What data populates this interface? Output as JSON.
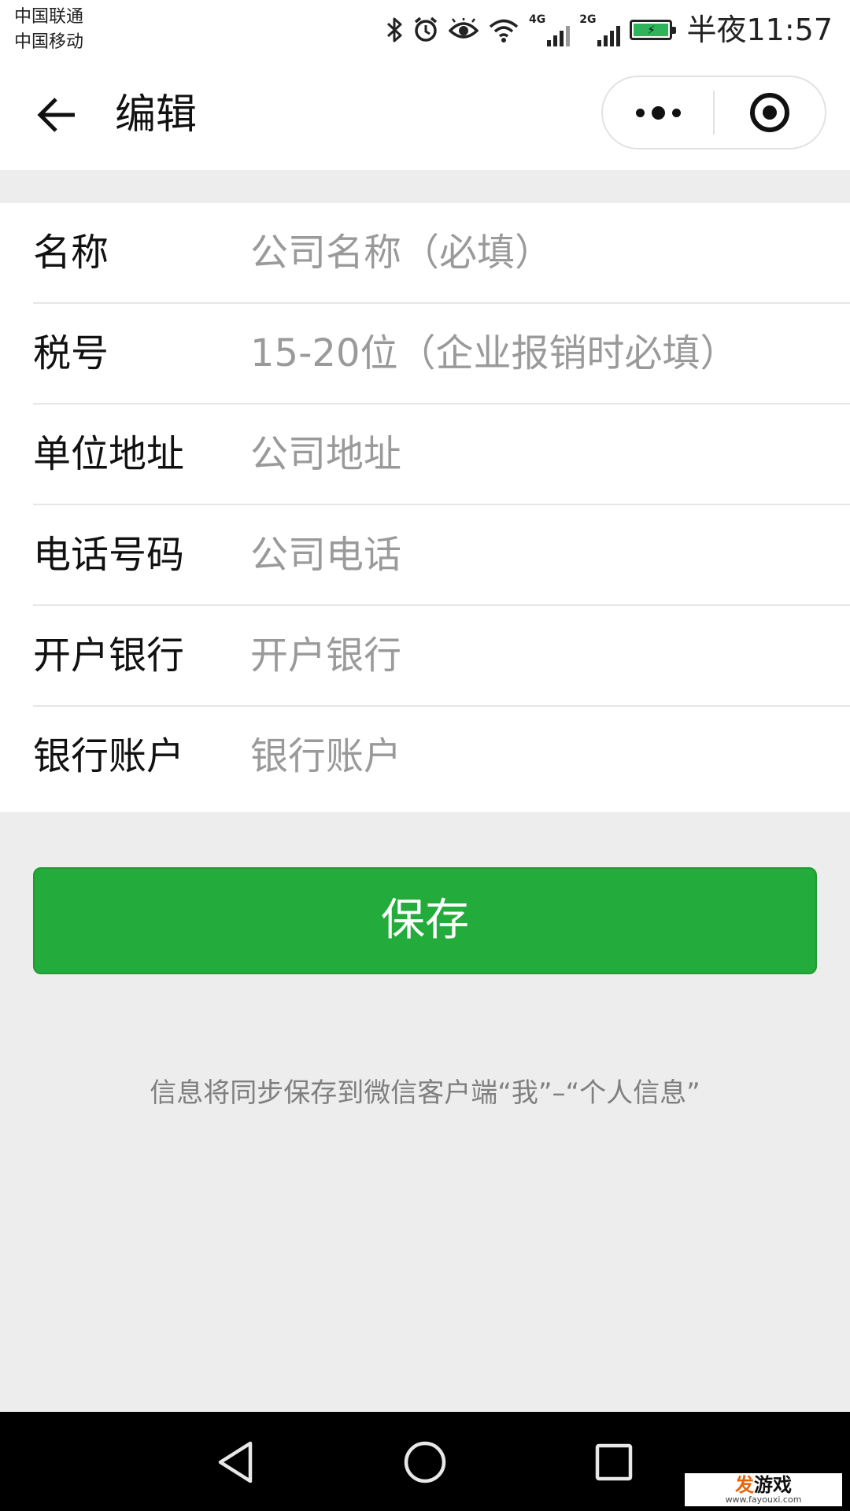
{
  "status_bar": {
    "carrier_1": "中国联通",
    "carrier_2": "中国移动",
    "icons": [
      "bluetooth-icon",
      "alarm-icon",
      "eye-icon",
      "wifi-icon",
      "signal-4g-icon",
      "signal-2g-icon",
      "battery-charging-icon"
    ],
    "network_1": "4G",
    "network_2": "2G",
    "time": "半夜11:57"
  },
  "nav_bar": {
    "title": "编辑",
    "back_icon": "arrow-left-icon",
    "more_icon": "more-dots-icon",
    "close_icon": "target-circle-icon"
  },
  "form": {
    "rows": [
      {
        "label": "名称",
        "value": "",
        "placeholder": "公司名称（必填）"
      },
      {
        "label": "税号",
        "value": "",
        "placeholder": "15-20位（企业报销时必填）"
      },
      {
        "label": "单位地址",
        "value": "",
        "placeholder": "公司地址"
      },
      {
        "label": "电话号码",
        "value": "",
        "placeholder": "公司电话"
      },
      {
        "label": "开户银行",
        "value": "",
        "placeholder": "开户银行"
      },
      {
        "label": "银行账户",
        "value": "",
        "placeholder": "银行账户"
      }
    ]
  },
  "save_button": {
    "label": "保存"
  },
  "sync_note": "信息将同步保存到微信客户端“我”–“个人信息”",
  "android_nav": {
    "back_icon": "triangle-back-icon",
    "home_icon": "circle-home-icon",
    "recents_icon": "square-recents-icon"
  },
  "watermark": {
    "brand_accent": "发",
    "brand_rest": "游戏",
    "url": "www.fayouxi.com"
  },
  "colors": {
    "accent_green": "#23ab3b",
    "background": "#ededed",
    "placeholder": "#9a9a9a",
    "note_text": "#7f7f7f"
  }
}
